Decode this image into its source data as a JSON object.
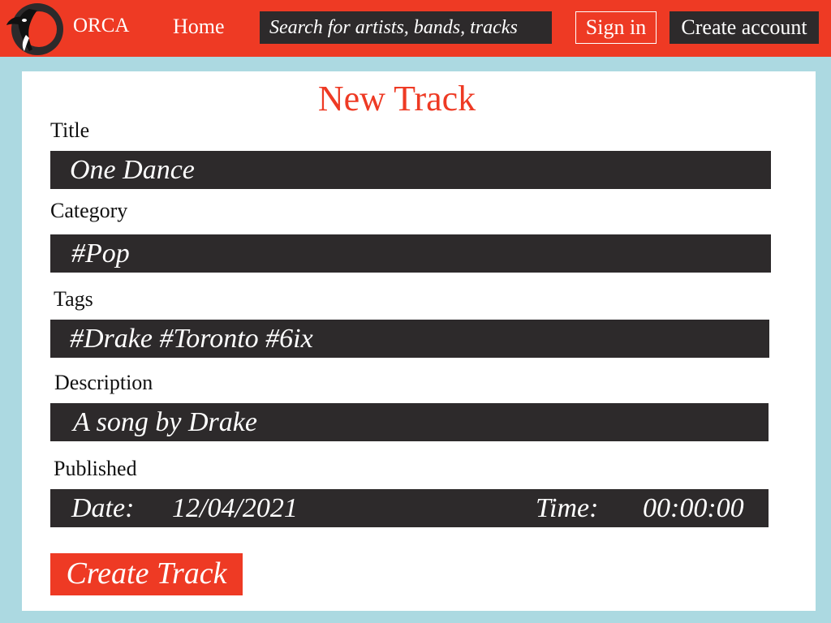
{
  "header": {
    "brand": "ORCA",
    "nav_home": "Home",
    "search_placeholder": "Search for artists, bands, tracks",
    "sign_in": "Sign in",
    "create_account": "Create account"
  },
  "form": {
    "heading": "New Track",
    "title_label": "Title",
    "title_value": "One Dance",
    "category_label": "Category",
    "category_value": "#Pop",
    "tags_label": "Tags",
    "tags_value": "#Drake #Toronto #6ix",
    "description_label": "Description",
    "description_value": "A song by Drake",
    "published_label": "Published",
    "date_label": "Date:",
    "date_value": "12/04/2021",
    "time_label": "Time:",
    "time_value": "00:00:00",
    "submit": "Create Track"
  },
  "colors": {
    "accent": "#ee3a24",
    "dark": "#2d2a2b",
    "page_bg": "#acd9e1"
  }
}
